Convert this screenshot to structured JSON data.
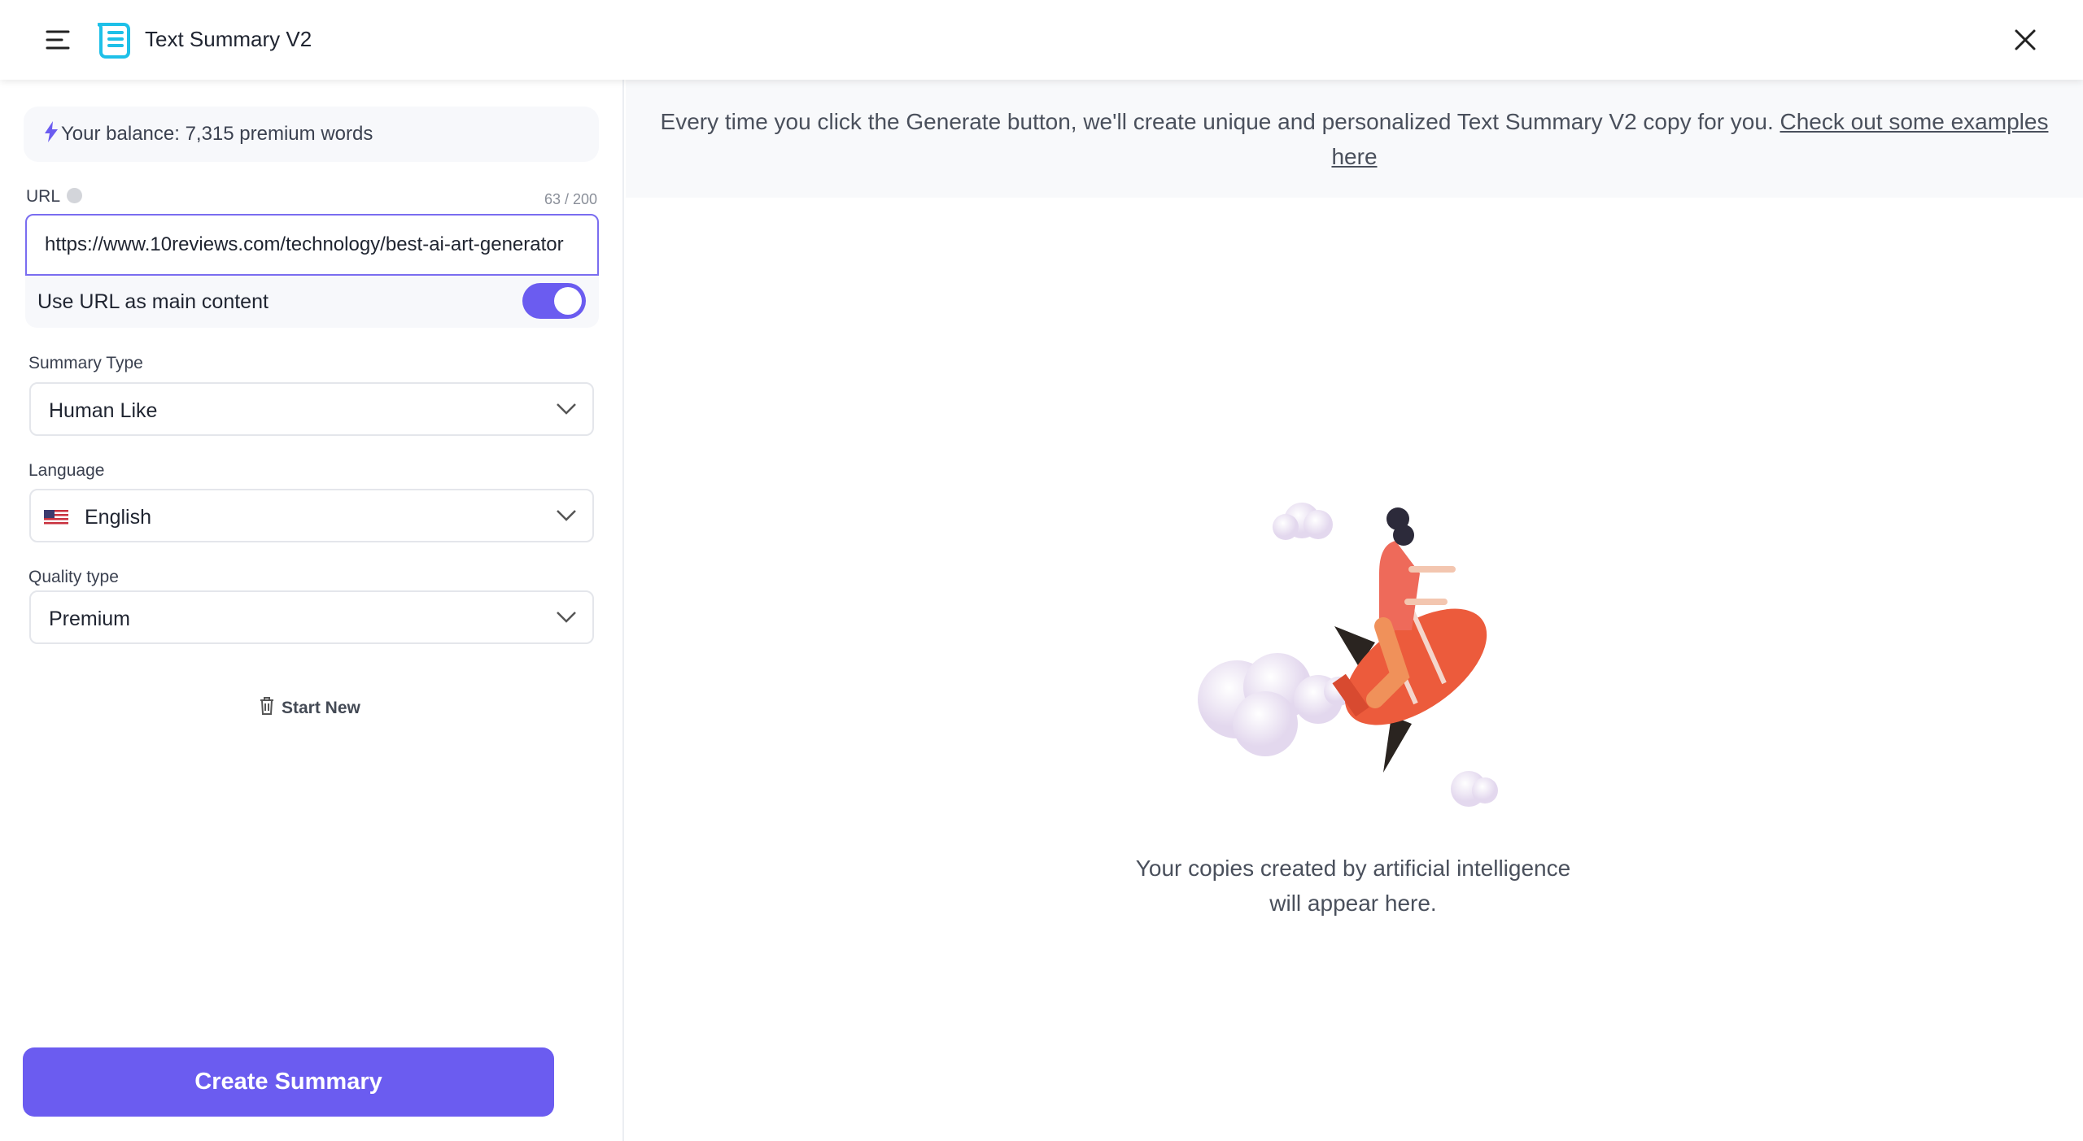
{
  "header": {
    "title": "Text Summary V2",
    "menu_icon": "hamburger-icon",
    "logo_icon": "scroll-icon",
    "close_icon": "close-icon"
  },
  "left": {
    "balance": "Your balance: 7,315 premium words",
    "url": {
      "label": "URL",
      "counter": "63 / 200",
      "value": "https://www.10reviews.com/technology/best-ai-art-generator"
    },
    "toggle": {
      "label": "Use URL as main content",
      "on": true
    },
    "summary_type": {
      "label": "Summary Type",
      "value": "Human Like"
    },
    "language": {
      "label": "Language",
      "value": "English"
    },
    "quality": {
      "label": "Quality type",
      "value": "Premium"
    },
    "start_new": "Start New",
    "create": "Create Summary"
  },
  "main": {
    "banner_text": "Every time you click the Generate button, we'll create unique and personalized Text Summary V2 copy for you. ",
    "banner_link": "Check out some examples here",
    "caption_1": "Your copies created by artificial intelligence",
    "caption_2": "will appear here."
  },
  "colors": {
    "accent": "#6b5cf0",
    "logo": "#1ec0e8"
  }
}
